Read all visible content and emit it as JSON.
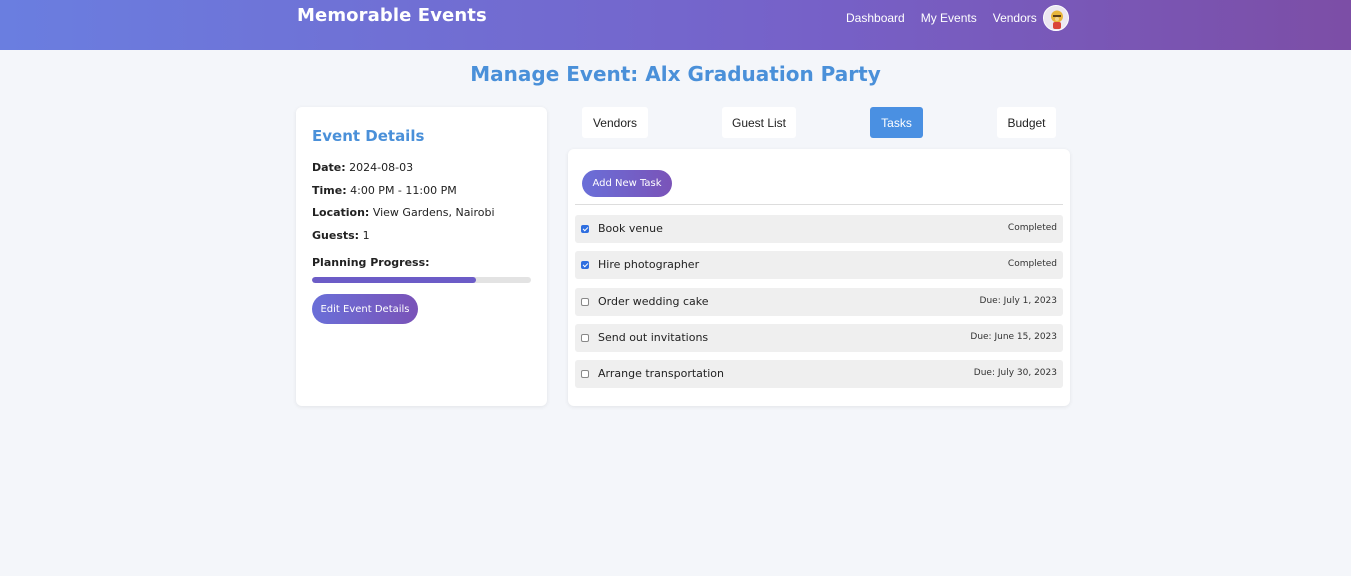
{
  "header": {
    "brand": "Memorable Events",
    "nav": [
      "Dashboard",
      "My Events",
      "Vendors"
    ]
  },
  "page": {
    "title": "Manage Event: Alx Graduation Party"
  },
  "details": {
    "heading": "Event Details",
    "date_label": "Date:",
    "date": "2024-08-03",
    "time_label": "Time:",
    "time": "4:00 PM - 11:00 PM",
    "location_label": "Location:",
    "location": "View Gardens, Nairobi",
    "guests_label": "Guests:",
    "guests": "1",
    "progress_label": "Planning Progress:",
    "progress_percent": 75,
    "edit_button": "Edit Event Details"
  },
  "tabs": [
    {
      "label": "Vendors",
      "active": false
    },
    {
      "label": "Guest List",
      "active": false
    },
    {
      "label": "Tasks",
      "active": true
    },
    {
      "label": "Budget",
      "active": false
    }
  ],
  "tasks_panel": {
    "add_button": "Add New Task",
    "tasks": [
      {
        "name": "Book venue",
        "status": "Completed",
        "checked": true
      },
      {
        "name": "Hire photographer",
        "status": "Completed",
        "checked": true
      },
      {
        "name": "Order wedding cake",
        "status": "Due: July 1, 2023",
        "checked": false
      },
      {
        "name": "Send out invitations",
        "status": "Due: June 15, 2023",
        "checked": false
      },
      {
        "name": "Arrange transportation",
        "status": "Due: July 30, 2023",
        "checked": false
      }
    ]
  },
  "colors": {
    "accent": "#4a90d9",
    "active_tab": "#4a90e2",
    "header_gradient_start": "#6a7ee0",
    "header_gradient_end": "#7c4ea6"
  }
}
